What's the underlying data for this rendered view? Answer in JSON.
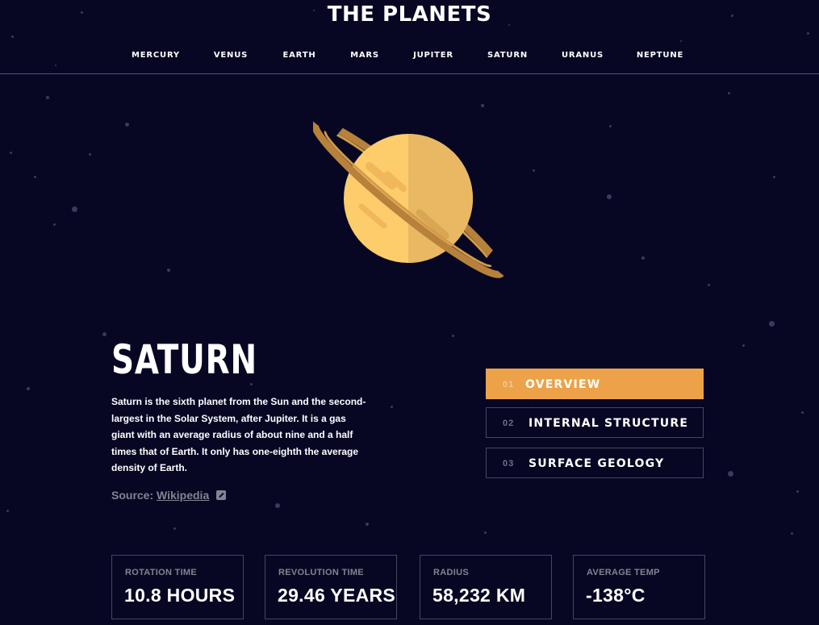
{
  "site": {
    "title": "THE PLANETS"
  },
  "nav": {
    "items": [
      {
        "label": "MERCURY"
      },
      {
        "label": "VENUS"
      },
      {
        "label": "EARTH"
      },
      {
        "label": "MARS"
      },
      {
        "label": "JUPITER"
      },
      {
        "label": "SATURN"
      },
      {
        "label": "URANUS"
      },
      {
        "label": "NEPTUNE"
      }
    ]
  },
  "planet": {
    "name": "SATURN",
    "description": "Saturn is the sixth planet from the Sun and the second-largest in the Solar System, after Jupiter. It is a gas giant with an average radius of about nine and a half times that of Earth. It only has one-eighth the average density of Earth.",
    "source_prefix": "Source:",
    "source_link": "Wikipedia",
    "source_icon": "external-link-icon",
    "accent_color": "#eda249"
  },
  "tabs": [
    {
      "number": "01",
      "label": "OVERVIEW",
      "active": true
    },
    {
      "number": "02",
      "label": "INTERNAL STRUCTURE",
      "active": false
    },
    {
      "number": "03",
      "label": "SURFACE GEOLOGY",
      "active": false
    }
  ],
  "stats": [
    {
      "label": "ROTATION TIME",
      "value": "10.8 HOURS"
    },
    {
      "label": "REVOLUTION TIME",
      "value": "29.46 YEARS"
    },
    {
      "label": "RADIUS",
      "value": "58,232 KM"
    },
    {
      "label": "AVERAGE TEMP",
      "value": "-138°C"
    }
  ],
  "colors": {
    "background": "#070724",
    "saturn_light": "#fccd6a",
    "saturn_dark": "#e8b962",
    "ring": "#b8813b",
    "border": "#45465e",
    "muted_text": "#838391"
  }
}
